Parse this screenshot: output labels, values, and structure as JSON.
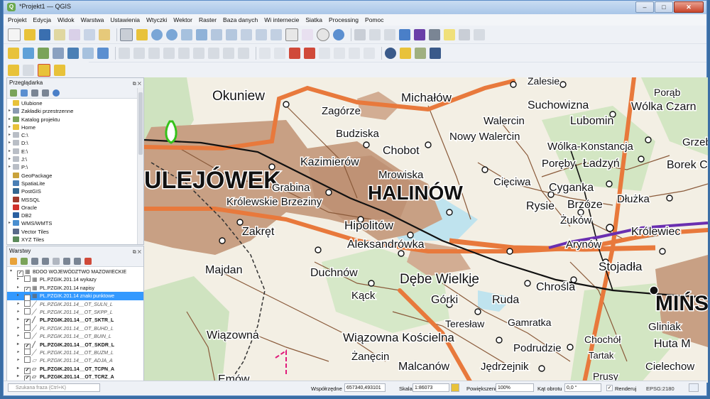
{
  "window": {
    "title": "*Projekt1 — QGIS",
    "minimize": "–",
    "maximize": "□",
    "close": "✕"
  },
  "menu": [
    "Projekt",
    "Edycja",
    "Widok",
    "Warstwa",
    "Ustawienia",
    "Wtyczki",
    "Wektor",
    "Raster",
    "Baza danych",
    "Wi internecie",
    "Siatka",
    "Processing",
    "Pomoc"
  ],
  "browser": {
    "title": "Przeglądarka",
    "items": [
      {
        "label": "Ulubione",
        "arrow": "",
        "icon": "#e8c23a"
      },
      {
        "label": "Zakładki przestrzenne",
        "arrow": "▸",
        "icon": "#8a9ab0"
      },
      {
        "label": "Katalog projektu",
        "arrow": "▸",
        "icon": "#7aa35a"
      },
      {
        "label": "Home",
        "arrow": "▸",
        "icon": "#e8c23a"
      },
      {
        "label": "C:\\",
        "arrow": "▸",
        "icon": "#b9bec6"
      },
      {
        "label": "D:\\",
        "arrow": "▸",
        "icon": "#b9bec6"
      },
      {
        "label": "E:\\",
        "arrow": "▸",
        "icon": "#b9bec6"
      },
      {
        "label": "J:\\",
        "arrow": "▸",
        "icon": "#b9bec6"
      },
      {
        "label": "P:\\",
        "arrow": "▸",
        "icon": "#b9bec6"
      },
      {
        "label": "GeoPackage",
        "arrow": "",
        "icon": "#c9a23b"
      },
      {
        "label": "SpatiaLite",
        "arrow": "",
        "icon": "#4a7fb5"
      },
      {
        "label": "PostGIS",
        "arrow": "",
        "icon": "#336791"
      },
      {
        "label": "MSSQL",
        "arrow": "",
        "icon": "#a03a2c"
      },
      {
        "label": "Oracle",
        "arrow": "",
        "icon": "#d0302a"
      },
      {
        "label": "DB2",
        "arrow": "",
        "icon": "#2a5fa0"
      },
      {
        "label": "WMS/WMTS",
        "arrow": "▸",
        "icon": "#4a8fd0"
      },
      {
        "label": "Vector Tiles",
        "arrow": "",
        "icon": "#5a6a8a"
      },
      {
        "label": "XYZ Tiles",
        "arrow": "",
        "icon": "#5a8a5a"
      }
    ]
  },
  "layers": {
    "title": "Warstwy",
    "items": [
      {
        "label": "BDOO WOJEWÓDZTWO MAZOWIECKIE",
        "arrow": "▾",
        "checked": "✓",
        "sym": "▦",
        "style": "",
        "indent": 0
      },
      {
        "label": "PL.PZGIK.201.14 wykazy",
        "arrow": "▸",
        "checked": "",
        "sym": "▦",
        "style": "",
        "indent": 1
      },
      {
        "label": "PL.PZGIK.201.14 napisy",
        "arrow": "▸",
        "checked": "✓",
        "sym": "▦",
        "style": "",
        "indent": 1
      },
      {
        "label": "PL.PZGIK.201.14 znaki punktowe",
        "arrow": "▸",
        "checked": "✓",
        "sym": "▦",
        "style": "sel",
        "indent": 1
      },
      {
        "label": "PL.PZGIK.201.14__OT_SULN_L",
        "arrow": "▸",
        "checked": "",
        "sym": "╱",
        "style": "ital",
        "indent": 1
      },
      {
        "label": "PL.PZGIK.201.14__OT_SKPP_L",
        "arrow": "▸",
        "checked": "",
        "sym": "╱",
        "style": "ital",
        "indent": 1
      },
      {
        "label": "PL.PZGIK.201.14__OT_SKTR_L",
        "arrow": "▸",
        "checked": "✓",
        "sym": "╱",
        "style": "bold",
        "indent": 1
      },
      {
        "label": "PL.PZGIK.201.14__OT_BUHD_L",
        "arrow": "▸",
        "checked": "",
        "sym": "╱",
        "style": "ital",
        "indent": 1
      },
      {
        "label": "PL.PZGIK.201.14__OT_BUIN_L",
        "arrow": "▸",
        "checked": "",
        "sym": "╱",
        "style": "ital",
        "indent": 1
      },
      {
        "label": "PL.PZGIK.201.14__OT_SKDR_L",
        "arrow": "▸",
        "checked": "✓",
        "sym": "╱",
        "style": "bold",
        "indent": 1
      },
      {
        "label": "PL.PZGIK.201.14__OT_BUZM_L",
        "arrow": "▸",
        "checked": "",
        "sym": "╱",
        "style": "ital",
        "indent": 1
      },
      {
        "label": "PL.PZGIK.201.14__OT_ADJA_A",
        "arrow": "▸",
        "checked": "",
        "sym": "▱",
        "style": "ital",
        "indent": 1
      },
      {
        "label": "PL.PZGIK.201.14__OT_TCPN_A",
        "arrow": "▸",
        "checked": "✓",
        "sym": "▱",
        "style": "bold",
        "indent": 1
      },
      {
        "label": "PL.PZGIK.201.14__OT_TCRZ_A",
        "arrow": "▸",
        "checked": "✓",
        "sym": "▱",
        "style": "bold",
        "indent": 1
      }
    ]
  },
  "map": {
    "labels": [
      {
        "text": "Okuniew",
        "size": 19,
        "weight": "normal"
      },
      {
        "text": "Michałów",
        "size": 17,
        "weight": "normal"
      },
      {
        "text": "Zagórze",
        "size": 15,
        "weight": "normal"
      },
      {
        "text": "Suchowizna",
        "size": 16,
        "weight": "normal"
      },
      {
        "text": "Porąb",
        "size": 14,
        "weight": "normal"
      },
      {
        "text": "Walercin",
        "size": 15,
        "weight": "normal"
      },
      {
        "text": "Lubomin",
        "size": 16,
        "weight": "normal"
      },
      {
        "text": "Wólka Czarn",
        "size": 16,
        "weight": "normal"
      },
      {
        "text": "Budziska",
        "size": 15,
        "weight": "normal"
      },
      {
        "text": "Nowy Walercin",
        "size": 15,
        "weight": "normal"
      },
      {
        "text": "Chobot",
        "size": 16,
        "weight": "normal"
      },
      {
        "text": "Wólka-Konstancja",
        "size": 15,
        "weight": "normal"
      },
      {
        "text": "Grzebowi",
        "size": 15,
        "weight": "normal"
      },
      {
        "text": "ULEJÓWEK",
        "size": 34,
        "weight": "bold"
      },
      {
        "text": "Kazimierów",
        "size": 16,
        "weight": "normal"
      },
      {
        "text": "Poręby",
        "size": 15,
        "weight": "normal"
      },
      {
        "text": "Ładzyń",
        "size": 16,
        "weight": "normal"
      },
      {
        "text": "Borek C",
        "size": 16,
        "weight": "normal"
      },
      {
        "text": "Mrowiska",
        "size": 15,
        "weight": "normal"
      },
      {
        "text": "Grabina",
        "size": 15,
        "weight": "normal"
      },
      {
        "text": "HALINÓW",
        "size": 28,
        "weight": "bold"
      },
      {
        "text": "Cięciwa",
        "size": 15,
        "weight": "normal"
      },
      {
        "text": "Cyganka",
        "size": 16,
        "weight": "normal"
      },
      {
        "text": "Dłużka",
        "size": 15,
        "weight": "normal"
      },
      {
        "text": "Królewskie Brzeziny",
        "size": 15,
        "weight": "normal"
      },
      {
        "text": "Rysie",
        "size": 16,
        "weight": "normal"
      },
      {
        "text": "Brzóze",
        "size": 16,
        "weight": "normal"
      },
      {
        "text": "Zakręt",
        "size": 16,
        "weight": "normal"
      },
      {
        "text": "Hipolitów",
        "size": 17,
        "weight": "normal"
      },
      {
        "text": "Żuków",
        "size": 15,
        "weight": "normal"
      },
      {
        "text": "Królewiec",
        "size": 16,
        "weight": "normal"
      },
      {
        "text": "Aleksandrówka",
        "size": 16,
        "weight": "normal"
      },
      {
        "text": "Arynów",
        "size": 15,
        "weight": "normal"
      },
      {
        "text": "Majdan",
        "size": 16,
        "weight": "normal"
      },
      {
        "text": "Duchnów",
        "size": 16,
        "weight": "normal"
      },
      {
        "text": "Stojadła",
        "size": 17,
        "weight": "normal"
      },
      {
        "text": "Dębe Wielkie",
        "size": 19,
        "weight": "normal"
      },
      {
        "text": "Chrośla",
        "size": 16,
        "weight": "normal"
      },
      {
        "text": "MIŃS",
        "size": 30,
        "weight": "bold"
      },
      {
        "text": "Kąck",
        "size": 15,
        "weight": "normal"
      },
      {
        "text": "Górki",
        "size": 16,
        "weight": "normal"
      },
      {
        "text": "Ruda",
        "size": 16,
        "weight": "normal"
      },
      {
        "text": "Teresław",
        "size": 14,
        "weight": "normal"
      },
      {
        "text": "Gamratka",
        "size": 14,
        "weight": "normal"
      },
      {
        "text": "Gliniak",
        "size": 15,
        "weight": "normal"
      },
      {
        "text": "Wiązowna",
        "size": 16,
        "weight": "normal"
      },
      {
        "text": "Wiązowna Kościelna",
        "size": 17,
        "weight": "normal"
      },
      {
        "text": "Chochół",
        "size": 14,
        "weight": "normal"
      },
      {
        "text": "Huta M",
        "size": 16,
        "weight": "normal"
      },
      {
        "text": "Podrudzie",
        "size": 15,
        "weight": "normal"
      },
      {
        "text": "Tartak",
        "size": 13,
        "weight": "normal"
      },
      {
        "text": "Żanęcin",
        "size": 15,
        "weight": "normal"
      },
      {
        "text": "Malcanów",
        "size": 16,
        "weight": "normal"
      },
      {
        "text": "Jędrzejnik",
        "size": 15,
        "weight": "normal"
      },
      {
        "text": "Cielechow",
        "size": 15,
        "weight": "normal"
      },
      {
        "text": "Emów",
        "size": 16,
        "weight": "normal"
      },
      {
        "text": "Prusy",
        "size": 14,
        "weight": "normal"
      },
      {
        "text": "Zalesie",
        "size": 14,
        "weight": "normal"
      }
    ]
  },
  "status": {
    "search_placeholder": "Szukana fraza (Ctrl+K)",
    "coord_label": "Współrzędne",
    "coord_value": "657340,493101",
    "scale_label": "Skala",
    "scale_value": "1:86073",
    "magnifier_label": "Powiększenie",
    "magnifier_value": "100%",
    "rotation_label": "Kąt obrotu",
    "rotation_value": "0,0 °",
    "render_label": "Renderuj",
    "crs_label": "EPSG:2180"
  },
  "colors": {
    "urban": "#c8a084",
    "main_road": "#e8793c",
    "forest": "#cfe3c0",
    "water": "#bfe3ee",
    "railway": "#111111",
    "selection": "#3399ff"
  }
}
